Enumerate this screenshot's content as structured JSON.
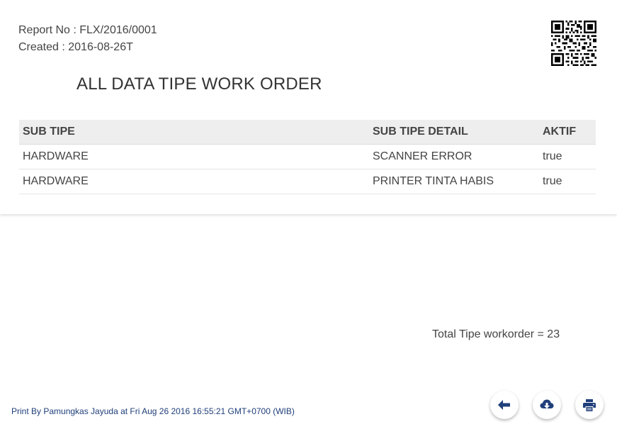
{
  "report": {
    "report_no": "Report No : FLX/2016/0001",
    "created": "Created : 2016-08-26T",
    "title": "ALL DATA TIPE WORK ORDER"
  },
  "table": {
    "headers": [
      "SUB TIPE",
      "SUB TIPE DETAIL",
      "AKTIF"
    ],
    "rows": [
      [
        "HARDWARE",
        "SCANNER ERROR",
        "true"
      ],
      [
        "HARDWARE",
        "PRINTER TINTA HABIS",
        "true"
      ]
    ]
  },
  "summary": {
    "total": "Total Tipe workorder = 23"
  },
  "footer": {
    "printed_by": "Print By Pamungkas Jayuda at Fri Aug 26 2016 16:55:21 GMT+0700 (WIB)"
  },
  "actions": {
    "back_icon": "arrow-left-icon",
    "download_icon": "cloud-download-icon",
    "print_icon": "printer-icon"
  },
  "colors": {
    "icon": "#1f3f7a",
    "header_bg": "#eeeeee",
    "footer_text": "#1f3f7a"
  }
}
